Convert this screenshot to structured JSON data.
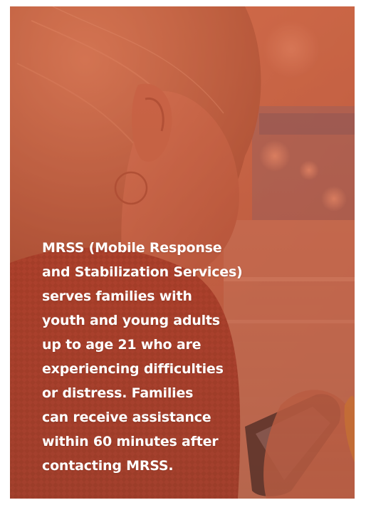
{
  "card": {
    "image": "girl-with-smartphone-photo",
    "overlay_color": "#c8583c",
    "message": "MRSS (Mobile Response\nand Stabilization Services)\nserves families with\nyouth and young adults\nup to age 21 who are\nexperiencing difficulties\nor distress. Families\ncan receive assistance\nwithin 60 minutes after\ncontacting MRSS."
  }
}
